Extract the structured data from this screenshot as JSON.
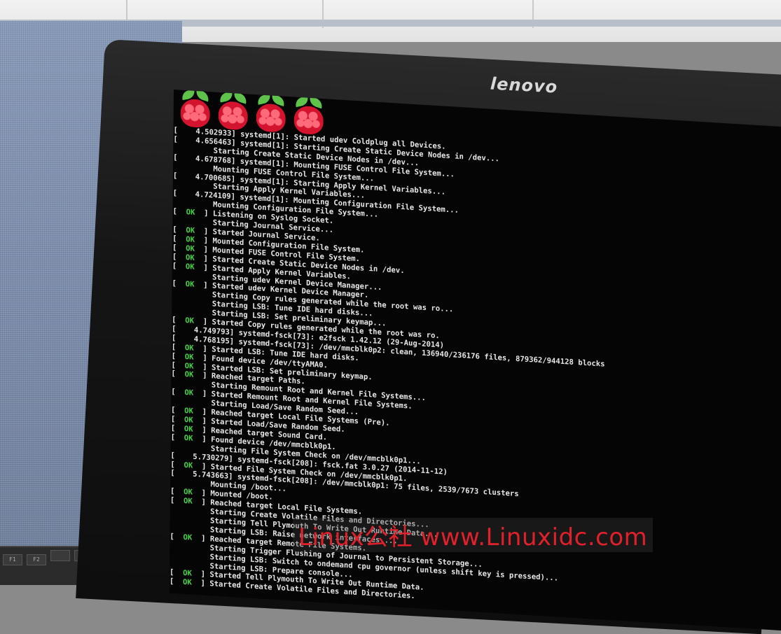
{
  "monitor": {
    "brand": "lenovo"
  },
  "screen": {
    "logo_count": 4,
    "lines": [
      {
        "ok": false,
        "text": "[    4.502933] systemd[1]: Started udev Coldplug all Devices."
      },
      {
        "ok": false,
        "text": "[    4.656463] systemd[1]: Starting Create Static Device Nodes in /dev..."
      },
      {
        "ok": false,
        "text": "         Starting Create Static Device Nodes in /dev..."
      },
      {
        "ok": false,
        "text": "[    4.678768] systemd[1]: Mounting FUSE Control File System..."
      },
      {
        "ok": false,
        "text": "         Mounting FUSE Control File System..."
      },
      {
        "ok": false,
        "text": "[    4.700685] systemd[1]: Starting Apply Kernel Variables..."
      },
      {
        "ok": false,
        "text": "         Starting Apply Kernel Variables..."
      },
      {
        "ok": false,
        "text": "[    4.724109] systemd[1]: Mounting Configuration File System..."
      },
      {
        "ok": false,
        "text": "         Mounting Configuration File System..."
      },
      {
        "ok": true,
        "text": "Listening on Syslog Socket."
      },
      {
        "ok": false,
        "text": "         Starting Journal Service..."
      },
      {
        "ok": true,
        "text": "Started Journal Service."
      },
      {
        "ok": true,
        "text": "Mounted Configuration File System."
      },
      {
        "ok": true,
        "text": "Mounted FUSE Control File System."
      },
      {
        "ok": true,
        "text": "Started Create Static Device Nodes in /dev."
      },
      {
        "ok": true,
        "text": "Started Apply Kernel Variables."
      },
      {
        "ok": false,
        "text": "         Starting udev Kernel Device Manager..."
      },
      {
        "ok": true,
        "text": "Started udev Kernel Device Manager."
      },
      {
        "ok": false,
        "text": "         Starting Copy rules generated while the root was ro..."
      },
      {
        "ok": false,
        "text": "         Starting LSB: Tune IDE hard disks..."
      },
      {
        "ok": false,
        "text": "         Starting LSB: Set preliminary keymap..."
      },
      {
        "ok": true,
        "text": "Started Copy rules generated while the root was ro."
      },
      {
        "ok": false,
        "text": "[    4.749793] systemd-fsck[73]: e2fsck 1.42.12 (29-Aug-2014)"
      },
      {
        "ok": false,
        "text": "[    4.768195] systemd-fsck[73]: /dev/mmcblk0p2: clean, 136940/236176 files, 879362/944128 blocks"
      },
      {
        "ok": true,
        "text": "Started LSB: Tune IDE hard disks."
      },
      {
        "ok": true,
        "text": "Found device /dev/ttyAMA0."
      },
      {
        "ok": true,
        "text": "Started LSB: Set preliminary keymap."
      },
      {
        "ok": true,
        "text": "Reached target Paths."
      },
      {
        "ok": false,
        "text": "         Starting Remount Root and Kernel File Systems..."
      },
      {
        "ok": true,
        "text": "Started Remount Root and Kernel File Systems."
      },
      {
        "ok": false,
        "text": "         Starting Load/Save Random Seed..."
      },
      {
        "ok": true,
        "text": "Reached target Local File Systems (Pre)."
      },
      {
        "ok": true,
        "text": "Started Load/Save Random Seed."
      },
      {
        "ok": true,
        "text": "Reached target Sound Card."
      },
      {
        "ok": true,
        "text": "Found device /dev/mmcblk0p1."
      },
      {
        "ok": false,
        "text": "         Starting File System Check on /dev/mmcblk0p1..."
      },
      {
        "ok": false,
        "text": "[    5.730279] systemd-fsck[208]: fsck.fat 3.0.27 (2014-11-12)"
      },
      {
        "ok": true,
        "text": "Started File System Check on /dev/mmcblk0p1."
      },
      {
        "ok": false,
        "text": "[    5.743663] systemd-fsck[208]: /dev/mmcblk0p1: 75 files, 2539/7673 clusters"
      },
      {
        "ok": false,
        "text": "         Mounting /boot..."
      },
      {
        "ok": true,
        "text": "Mounted /boot."
      },
      {
        "ok": true,
        "text": "Reached target Local File Systems."
      },
      {
        "ok": false,
        "text": "         Starting Create Volatile Files and Directories..."
      },
      {
        "ok": false,
        "text": "         Starting Tell Plymouth To Write Out Runtime Data..."
      },
      {
        "ok": false,
        "text": "         Starting LSB: Raise network interfaces...."
      },
      {
        "ok": true,
        "text": "Reached target Remote File Systems."
      },
      {
        "ok": false,
        "text": "         Starting Trigger Flushing of Journal to Persistent Storage..."
      },
      {
        "ok": false,
        "text": "         Starting LSB: Switch to ondemand cpu governor (unless shift key is pressed)..."
      },
      {
        "ok": false,
        "text": "         Starting LSB: Prepare console..."
      },
      {
        "ok": true,
        "text": "Started Tell Plymouth To Write Out Runtime Data."
      },
      {
        "ok": true,
        "text": "Started Create Volatile Files and Directories."
      }
    ],
    "ok_label": "  OK  "
  },
  "watermark": {
    "text": "Linux公社 www.Linuxidc.com"
  },
  "colors": {
    "ok": "#43d343",
    "text": "#e6e6e6",
    "screen_bg": "#050505",
    "watermark": "#e0202a"
  }
}
